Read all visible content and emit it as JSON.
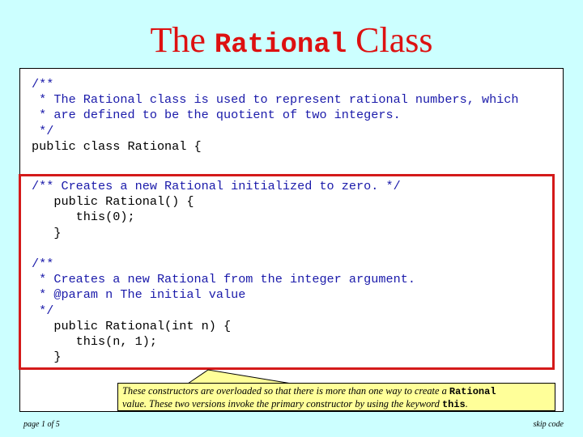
{
  "title": {
    "prefix": "The",
    "code_word": "Rational",
    "suffix": "Class"
  },
  "code": {
    "class_header": [
      {
        "text": "/**",
        "kind": "comment"
      },
      {
        "text": " * The Rational class is used to represent rational numbers, which",
        "kind": "comment"
      },
      {
        "text": " * are defined to be the quotient of two integers.",
        "kind": "comment"
      },
      {
        "text": " */",
        "kind": "comment"
      },
      {
        "text": "public class Rational {",
        "kind": "code"
      }
    ],
    "constructor_zero": [
      {
        "text": "/** Creates a new Rational initialized to zero. */",
        "kind": "comment"
      },
      {
        "text": "   public Rational() {",
        "kind": "code"
      },
      {
        "text": "      this(0);",
        "kind": "code"
      },
      {
        "text": "   }",
        "kind": "code"
      }
    ],
    "constructor_int": [
      {
        "text": "/**",
        "kind": "comment"
      },
      {
        "text": " * Creates a new Rational from the integer argument.",
        "kind": "comment"
      },
      {
        "text": " * @param n The initial value",
        "kind": "comment"
      },
      {
        "text": " */",
        "kind": "comment"
      },
      {
        "text": "   public Rational(int n) {",
        "kind": "code"
      },
      {
        "text": "      this(n, 1);",
        "kind": "code"
      },
      {
        "text": "   }",
        "kind": "code"
      }
    ]
  },
  "callout": {
    "line1_text": "These constructors are overloaded so that there is more than one way to create a ",
    "line1_keyword": "Rational",
    "line2_text": "value.  These two versions invoke the primary constructor by using the keyword ",
    "line2_keyword": "this",
    "line2_end": "."
  },
  "footer": {
    "page_indicator": "page 1 of 5",
    "skip_link": "skip code"
  },
  "colors": {
    "background": "#ccffff",
    "title": "#dd1111",
    "comment": "#1a1aaa",
    "highlight_border": "#d41a1a",
    "callout_fill": "#ffff99"
  }
}
